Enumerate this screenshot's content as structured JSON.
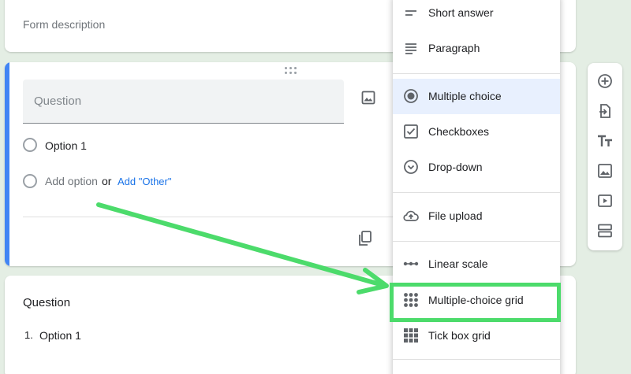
{
  "form": {
    "description_placeholder": "Form description"
  },
  "question_card": {
    "question_placeholder": "Question",
    "options": [
      "Option 1"
    ],
    "add_option_label": "Add option",
    "or_label": "or",
    "add_other_label": "Add \"Other\""
  },
  "second_card": {
    "title": "Question",
    "option_number": "1.",
    "option_label": "Option 1"
  },
  "type_menu": {
    "items": [
      {
        "label": "Short answer",
        "icon": "short-answer-icon"
      },
      {
        "label": "Paragraph",
        "icon": "paragraph-icon"
      },
      {
        "label": "Multiple choice",
        "icon": "radio-icon",
        "selected": true
      },
      {
        "label": "Checkboxes",
        "icon": "checkbox-icon"
      },
      {
        "label": "Drop-down",
        "icon": "dropdown-icon"
      },
      {
        "label": "File upload",
        "icon": "upload-cloud-icon"
      },
      {
        "label": "Linear scale",
        "icon": "linear-scale-icon"
      },
      {
        "label": "Multiple-choice grid",
        "icon": "grid-dots-icon",
        "highlighted": true
      },
      {
        "label": "Tick box grid",
        "icon": "grid-squares-icon"
      }
    ]
  },
  "toolbar": {
    "buttons": [
      "add-question-icon",
      "import-questions-icon",
      "add-title-icon",
      "add-image-icon",
      "add-video-icon",
      "add-section-icon"
    ]
  },
  "colors": {
    "accent": "#4285f4",
    "annotation": "#4cdb6b",
    "selected_bg": "#e8f0fe"
  }
}
